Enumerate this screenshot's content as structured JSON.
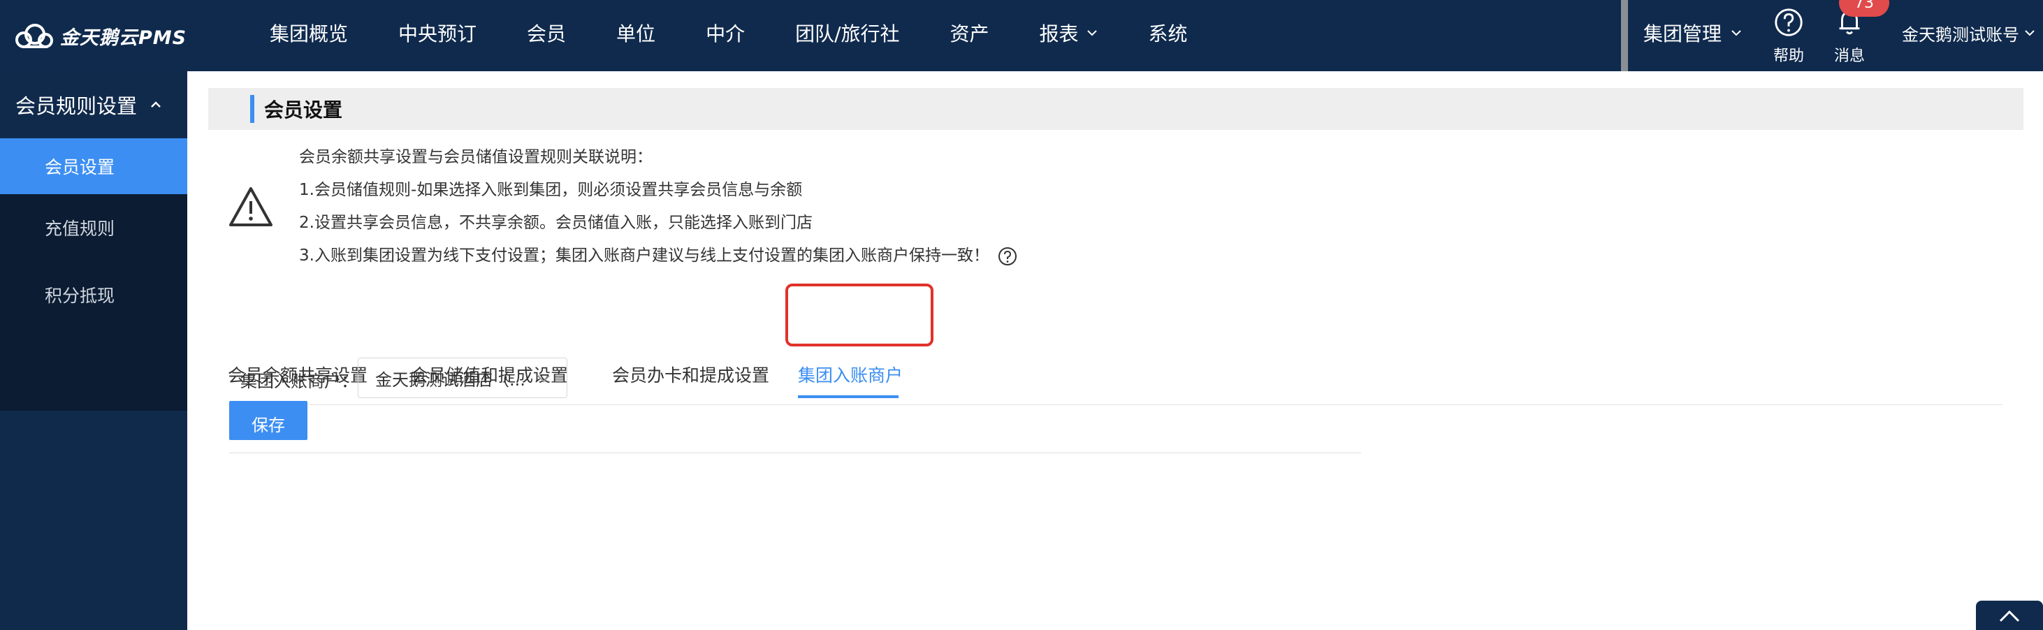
{
  "app": {
    "logo_text": "金天鹅云PMS"
  },
  "topnav": {
    "items": [
      {
        "label": "集团概览"
      },
      {
        "label": "中央预订"
      },
      {
        "label": "会员"
      },
      {
        "label": "单位"
      },
      {
        "label": "中介"
      },
      {
        "label": "团队/旅行社"
      },
      {
        "label": "资产"
      },
      {
        "label": "报表"
      },
      {
        "label": "系统"
      }
    ],
    "group_mgmt": "集团管理",
    "help_label": "帮助",
    "message_label": "消息",
    "message_badge": "73",
    "account": "金天鹅测试账号"
  },
  "sidebar": {
    "header": "会员规则设置",
    "items": [
      {
        "label": "会员设置",
        "active": true
      },
      {
        "label": "充值规则",
        "active": false
      },
      {
        "label": "积分抵现",
        "active": false
      }
    ]
  },
  "page": {
    "title": "会员设置",
    "notes": [
      "会员余额共享设置与会员储值设置规则关联说明：",
      "1.会员储值规则-如果选择入账到集团，则必须设置共享会员信息与余额",
      "2.设置共享会员信息，不共享余额。会员储值入账，只能选择入账到门店",
      "3.入账到集团设置为线下支付设置；集团入账商户建议与线上支付设置的集团入账商户保持一致！"
    ],
    "tabs": [
      {
        "label": "会员余额共享设置",
        "active": false
      },
      {
        "label": "会员储值和提成设置",
        "active": false
      },
      {
        "label": "会员办卡和提成设置",
        "active": false
      },
      {
        "label": "集团入账商户",
        "active": true
      }
    ],
    "form": {
      "merchant_label": "集团入账商户：",
      "merchant_value": "金天鹅测试酒店（...",
      "save_label": "保存"
    }
  },
  "colors": {
    "nav_bg": "#0f2a4d",
    "accent": "#3c8ef2",
    "highlight": "#e0322a",
    "badge": "#e24b4b"
  },
  "icons": [
    "cloud-logo-icon",
    "chevron-down-icon",
    "chevron-up-icon",
    "help-icon",
    "bell-icon",
    "warning-icon",
    "question-icon",
    "arrow-up-icon"
  ]
}
